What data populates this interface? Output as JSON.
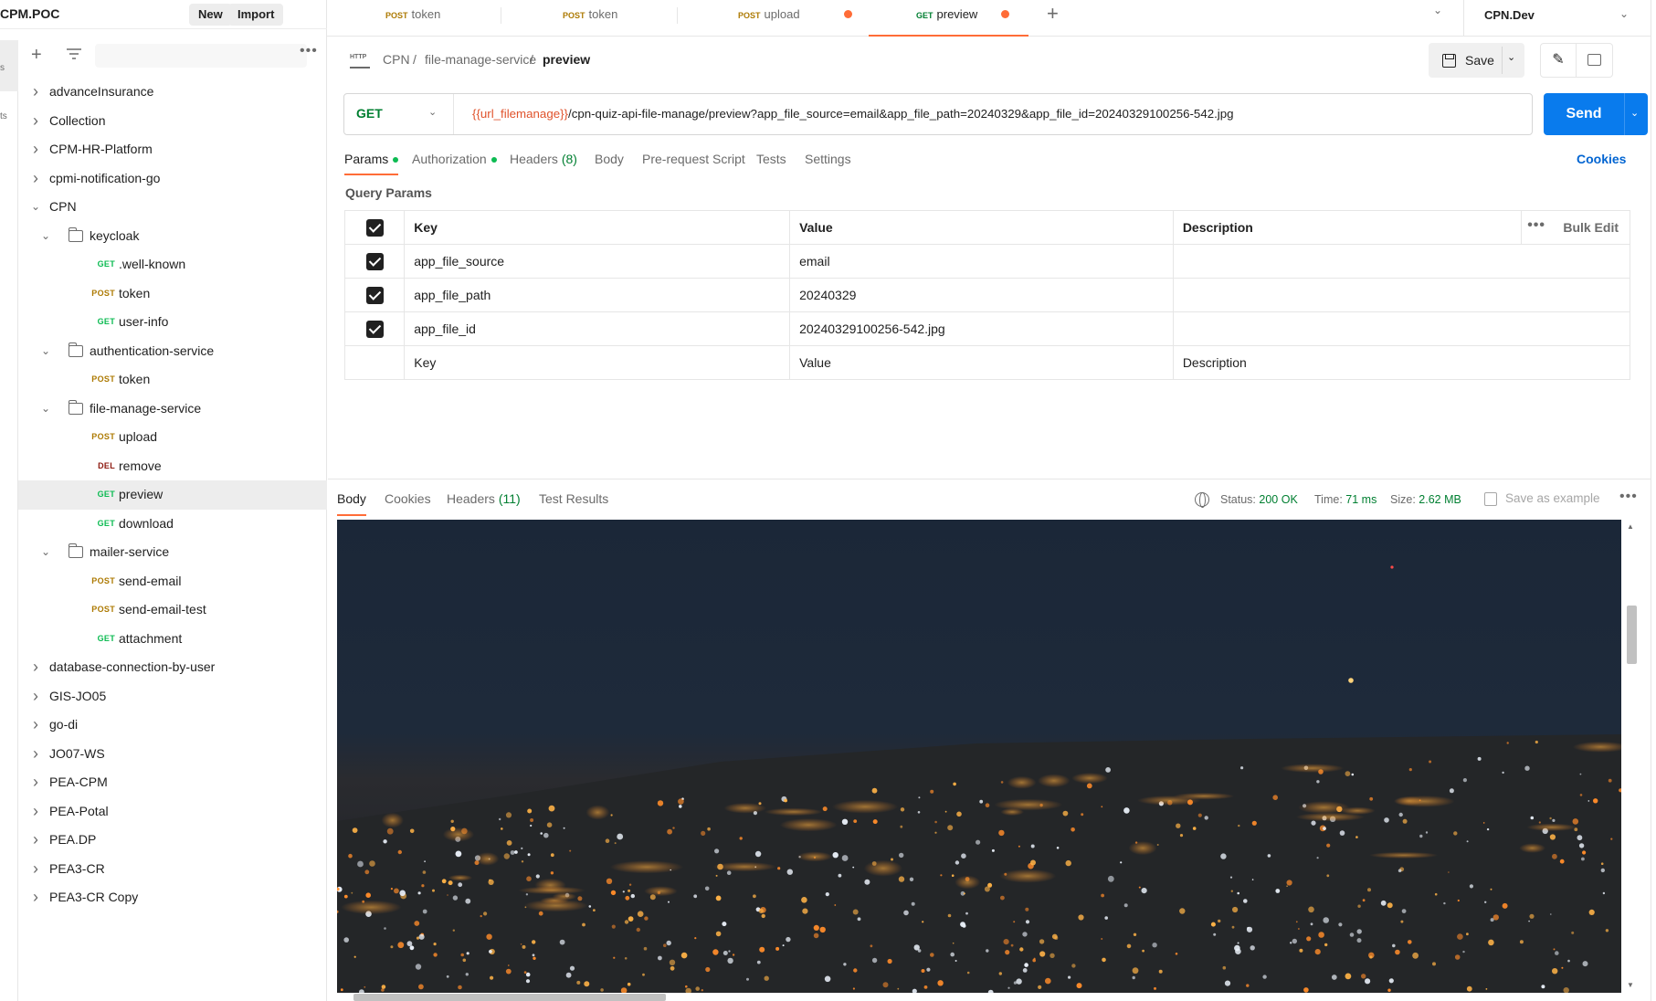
{
  "sidebar": {
    "workspace_name": "CPM.POC",
    "new_label": "New",
    "import_label": "Import",
    "rail_labels": [
      "s",
      "ts"
    ],
    "tree": [
      {
        "type": "collection",
        "label": "advanceInsurance",
        "expanded": false
      },
      {
        "type": "collection",
        "label": "Collection",
        "expanded": false
      },
      {
        "type": "collection",
        "label": "CPM-HR-Platform",
        "expanded": false
      },
      {
        "type": "collection",
        "label": "cpmi-notification-go",
        "expanded": false
      },
      {
        "type": "collection",
        "label": "CPN",
        "expanded": true
      },
      {
        "type": "folder",
        "label": "keycloak",
        "expanded": true
      },
      {
        "type": "request",
        "method": "GET",
        "label": ".well-known"
      },
      {
        "type": "request",
        "method": "POST",
        "label": "token"
      },
      {
        "type": "request",
        "method": "GET",
        "label": "user-info"
      },
      {
        "type": "folder",
        "label": "authentication-service",
        "expanded": true
      },
      {
        "type": "request",
        "method": "POST",
        "label": "token"
      },
      {
        "type": "folder",
        "label": "file-manage-service",
        "expanded": true
      },
      {
        "type": "request",
        "method": "POST",
        "label": "upload"
      },
      {
        "type": "request",
        "method": "DEL",
        "label": "remove"
      },
      {
        "type": "request",
        "method": "GET",
        "label": "preview",
        "selected": true
      },
      {
        "type": "request",
        "method": "GET",
        "label": "download"
      },
      {
        "type": "folder",
        "label": "mailer-service",
        "expanded": true
      },
      {
        "type": "request",
        "method": "POST",
        "label": "send-email"
      },
      {
        "type": "request",
        "method": "POST",
        "label": "send-email-test"
      },
      {
        "type": "request",
        "method": "GET",
        "label": "attachment"
      },
      {
        "type": "collection",
        "label": "database-connection-by-user",
        "expanded": false
      },
      {
        "type": "collection",
        "label": "GIS-JO05",
        "expanded": false
      },
      {
        "type": "collection",
        "label": "go-di",
        "expanded": false
      },
      {
        "type": "collection",
        "label": "JO07-WS",
        "expanded": false
      },
      {
        "type": "collection",
        "label": "PEA-CPM",
        "expanded": false
      },
      {
        "type": "collection",
        "label": "PEA-Potal",
        "expanded": false
      },
      {
        "type": "collection",
        "label": "PEA.DP",
        "expanded": false
      },
      {
        "type": "collection",
        "label": "PEA3-CR",
        "expanded": false
      },
      {
        "type": "collection",
        "label": "PEA3-CR Copy",
        "expanded": false
      }
    ]
  },
  "tabs": [
    {
      "method": "POST",
      "label": "token",
      "unsaved": false,
      "active": false
    },
    {
      "method": "POST",
      "label": "token",
      "unsaved": false,
      "active": false
    },
    {
      "method": "POST",
      "label": "upload",
      "unsaved": true,
      "active": false
    },
    {
      "method": "GET",
      "label": "preview",
      "unsaved": true,
      "active": true
    }
  ],
  "environment": {
    "name": "CPN.Dev"
  },
  "breadcrumb": {
    "icon_text": "HTTP",
    "items": [
      "CPN",
      "file-manage-service"
    ],
    "current": "preview",
    "separator": "/"
  },
  "actions": {
    "save_label": "Save"
  },
  "request": {
    "method": "GET",
    "url_variable": "{{url_filemanage}}",
    "url_path": "/cpn-quiz-api-file-manage/preview?app_file_source=email&app_file_path=20240329&app_file_id=20240329100256-542.jpg",
    "send_label": "Send"
  },
  "request_tabs": {
    "params": "Params",
    "authorization": "Authorization",
    "headers": "Headers",
    "headers_count": "(8)",
    "body": "Body",
    "pre_request": "Pre-request Script",
    "tests": "Tests",
    "settings": "Settings",
    "cookies": "Cookies"
  },
  "query_params": {
    "title": "Query Params",
    "columns": {
      "key": "Key",
      "value": "Value",
      "description": "Description"
    },
    "bulk_edit": "Bulk Edit",
    "rows": [
      {
        "key": "app_file_source",
        "value": "email",
        "description": "",
        "checked": true
      },
      {
        "key": "app_file_path",
        "value": "20240329",
        "description": "",
        "checked": true
      },
      {
        "key": "app_file_id",
        "value": "20240329100256-542.jpg",
        "description": "",
        "checked": true
      }
    ],
    "placeholder": {
      "key": "Key",
      "value": "Value",
      "description": "Description"
    }
  },
  "response": {
    "tabs": {
      "body": "Body",
      "cookies": "Cookies",
      "headers": "Headers",
      "headers_count": "(11)",
      "test_results": "Test Results"
    },
    "status_label": "Status:",
    "status_value": "200 OK",
    "time_label": "Time:",
    "time_value": "71 ms",
    "size_label": "Size:",
    "size_value": "2.62 MB",
    "save_example": "Save as example"
  },
  "colors": {
    "accent_orange": "#ff6c37",
    "send_blue": "#097bed",
    "get_green": "#0cbb52",
    "post_amber": "#ad7a03",
    "delete_red": "#8e1a10",
    "url_variable": "#e0532c"
  }
}
